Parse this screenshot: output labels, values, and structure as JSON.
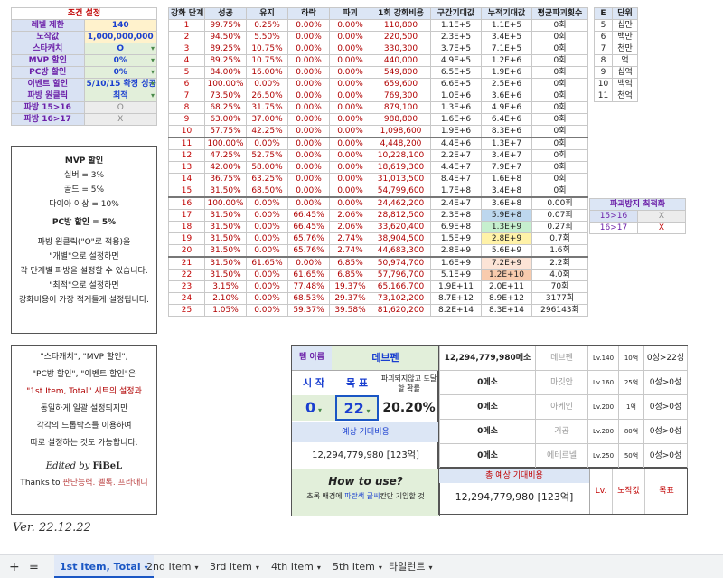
{
  "condition": {
    "title": "조건 설정",
    "rows": [
      {
        "label": "레벨 제한",
        "value": "140",
        "style": "val"
      },
      {
        "label": "노작값",
        "value": "1,000,000,000",
        "style": "val"
      },
      {
        "label": "스타캐치",
        "value": "O",
        "style": "sel"
      },
      {
        "label": "MVP 할인",
        "value": "0%",
        "style": "sel"
      },
      {
        "label": "PC방 할인",
        "value": "0%",
        "style": "sel"
      },
      {
        "label": "이벤트 할인",
        "value": "5/10/15 확정 성공",
        "style": "sel"
      },
      {
        "label": "파방 원클릭",
        "value": "최적",
        "style": "sel"
      },
      {
        "label": "파방 15>16",
        "value": "O",
        "style": "gray"
      },
      {
        "label": "파방 16>17",
        "value": "X",
        "style": "gray"
      }
    ]
  },
  "notes1": {
    "title": "MVP 할인",
    "lines": [
      "실버 = 3%",
      "골드 = 5%",
      "다이아 이상 = 10%"
    ],
    "pc": "PC방 할인 = 5%",
    "p1": "파방 원클릭(\"O\"로 적용)을",
    "p2": "\"개별\"으로 설정하면",
    "p3": "각 단계별 파방을 설정할 수 있습니다.",
    "p4": "\"최적\"으로 설정하면",
    "p5": "강화비용이 가장 적게들게 설정됩니다."
  },
  "notes2": {
    "l1": "\"스타캐치\", \"MVP 할인\",",
    "l2": "\"PC방 할인\", \"이벤트 할인\"은",
    "l3": "\"1st Item, Total\" 시트의 설정과",
    "l4": "동일하게 일괄 설정되지만",
    "l5": "각각의 드롭박스를 이용하여",
    "l6": "따로 설정하는 것도 가능합니다.",
    "edited": "Edited by",
    "author": "FiBeL",
    "thanks": "Thanks to",
    "thanks_names": "판단능력. 펠톡. 프라애니",
    "version": "Ver. 22.12.22"
  },
  "main": {
    "headers": [
      "강화 단계",
      "성공",
      "유지",
      "하락",
      "파괴",
      "1회 강화비용",
      "구간기대값",
      "누적기대값",
      "평균파괴횟수"
    ],
    "rows": [
      [
        "1",
        "99.75%",
        "0.25%",
        "0.00%",
        "0.00%",
        "110,800",
        "1.1E+5",
        "1.1E+5",
        "0회"
      ],
      [
        "2",
        "94.50%",
        "5.50%",
        "0.00%",
        "0.00%",
        "220,500",
        "2.3E+5",
        "3.4E+5",
        "0회"
      ],
      [
        "3",
        "89.25%",
        "10.75%",
        "0.00%",
        "0.00%",
        "330,300",
        "3.7E+5",
        "7.1E+5",
        "0회"
      ],
      [
        "4",
        "89.25%",
        "10.75%",
        "0.00%",
        "0.00%",
        "440,000",
        "4.9E+5",
        "1.2E+6",
        "0회"
      ],
      [
        "5",
        "84.00%",
        "16.00%",
        "0.00%",
        "0.00%",
        "549,800",
        "6.5E+5",
        "1.9E+6",
        "0회"
      ],
      [
        "6",
        "100.00%",
        "0.00%",
        "0.00%",
        "0.00%",
        "659,600",
        "6.6E+5",
        "2.5E+6",
        "0회"
      ],
      [
        "7",
        "73.50%",
        "26.50%",
        "0.00%",
        "0.00%",
        "769,300",
        "1.0E+6",
        "3.6E+6",
        "0회"
      ],
      [
        "8",
        "68.25%",
        "31.75%",
        "0.00%",
        "0.00%",
        "879,100",
        "1.3E+6",
        "4.9E+6",
        "0회"
      ],
      [
        "9",
        "63.00%",
        "37.00%",
        "0.00%",
        "0.00%",
        "988,800",
        "1.6E+6",
        "6.4E+6",
        "0회"
      ],
      [
        "10",
        "57.75%",
        "42.25%",
        "0.00%",
        "0.00%",
        "1,098,600",
        "1.9E+6",
        "8.3E+6",
        "0회"
      ],
      [
        "11",
        "100.00%",
        "0.00%",
        "0.00%",
        "0.00%",
        "4,448,200",
        "4.4E+6",
        "1.3E+7",
        "0회"
      ],
      [
        "12",
        "47.25%",
        "52.75%",
        "0.00%",
        "0.00%",
        "10,228,100",
        "2.2E+7",
        "3.4E+7",
        "0회"
      ],
      [
        "13",
        "42.00%",
        "58.00%",
        "0.00%",
        "0.00%",
        "18,619,300",
        "4.4E+7",
        "7.9E+7",
        "0회"
      ],
      [
        "14",
        "36.75%",
        "63.25%",
        "0.00%",
        "0.00%",
        "31,013,500",
        "8.4E+7",
        "1.6E+8",
        "0회"
      ],
      [
        "15",
        "31.50%",
        "68.50%",
        "0.00%",
        "0.00%",
        "54,799,600",
        "1.7E+8",
        "3.4E+8",
        "0회"
      ],
      [
        "16",
        "100.00%",
        "0.00%",
        "0.00%",
        "0.00%",
        "24,462,200",
        "2.4E+7",
        "3.6E+8",
        "0.00회"
      ],
      [
        "17",
        "31.50%",
        "0.00%",
        "66.45%",
        "2.06%",
        "28,812,500",
        "2.3E+8",
        "5.9E+8",
        "0.07회"
      ],
      [
        "18",
        "31.50%",
        "0.00%",
        "66.45%",
        "2.06%",
        "33,620,400",
        "6.9E+8",
        "1.3E+9",
        "0.27회"
      ],
      [
        "19",
        "31.50%",
        "0.00%",
        "65.76%",
        "2.74%",
        "38,904,500",
        "1.5E+9",
        "2.8E+9",
        "0.7회"
      ],
      [
        "20",
        "31.50%",
        "0.00%",
        "65.76%",
        "2.74%",
        "44,683,300",
        "2.8E+9",
        "5.6E+9",
        "1.6회"
      ],
      [
        "21",
        "31.50%",
        "61.65%",
        "0.00%",
        "6.85%",
        "50,974,700",
        "1.6E+9",
        "7.2E+9",
        "2.2회"
      ],
      [
        "22",
        "31.50%",
        "0.00%",
        "61.65%",
        "6.85%",
        "57,796,700",
        "5.1E+9",
        "1.2E+10",
        "4.0회"
      ],
      [
        "23",
        "3.15%",
        "0.00%",
        "77.48%",
        "19.37%",
        "65,166,700",
        "1.9E+11",
        "2.0E+11",
        "70회"
      ],
      [
        "24",
        "2.10%",
        "0.00%",
        "68.53%",
        "29.37%",
        "73,102,200",
        "8.7E+12",
        "8.9E+12",
        "3177회"
      ],
      [
        "25",
        "1.05%",
        "0.00%",
        "59.37%",
        "39.58%",
        "81,620,200",
        "8.2E+14",
        "8.3E+14",
        "296143회"
      ]
    ]
  },
  "units": {
    "headers": [
      "E",
      "단위"
    ],
    "rows": [
      [
        "5",
        "십만"
      ],
      [
        "6",
        "백만"
      ],
      [
        "7",
        "천만"
      ],
      [
        "8",
        "억"
      ],
      [
        "9",
        "십억"
      ],
      [
        "10",
        "백억"
      ],
      [
        "11",
        "천억"
      ]
    ]
  },
  "protect": {
    "title": "파괴방지 최적화",
    "rows": [
      [
        "15>16",
        "X"
      ],
      [
        "16>17",
        "X"
      ]
    ]
  },
  "calc": {
    "item_label": "템 이름",
    "item_name": "데브펜",
    "start_label": "시 작",
    "goal_label": "목 표",
    "nodestroy_label": "파괴되지않고 도달할 확률",
    "start": "0",
    "goal": "22",
    "prob": "20.20%",
    "expected_label": "예상 기대비용",
    "expected": "12,294,779,980 [123억]",
    "howto": "How to use?",
    "howto_desc_pre": "초록 배경에 ",
    "howto_desc_hl": "파란색 글씨",
    "howto_desc_post": "칸만 기입할 것",
    "total_label": "총 예상 기대비용",
    "total": "12,294,779,980 [123억]"
  },
  "summary": {
    "rows": [
      [
        "12,294,779,980메소",
        "데브펜",
        "Lv.140",
        "10억",
        "0성>22성"
      ],
      [
        "0메소",
        "마깃안",
        "Lv.160",
        "25억",
        "0성>0성"
      ],
      [
        "0메소",
        "아케인",
        "Lv.200",
        "1억",
        "0성>0성"
      ],
      [
        "0메소",
        "거공",
        "Lv.200",
        "80억",
        "0성>0성"
      ],
      [
        "0메소",
        "에테르넬",
        "Lv.250",
        "50억",
        "0성>0성"
      ]
    ],
    "foot": [
      "Lv.",
      "노작값",
      "목표"
    ]
  },
  "tabs": {
    "items": [
      "1st Item, Total",
      "2nd Item",
      "3rd Item",
      "4th Item",
      "5th Item",
      "타일런트"
    ]
  },
  "colors": {
    "accent": "#1a56c4",
    "header": "#dce6f5",
    "green": "#c6efce"
  }
}
